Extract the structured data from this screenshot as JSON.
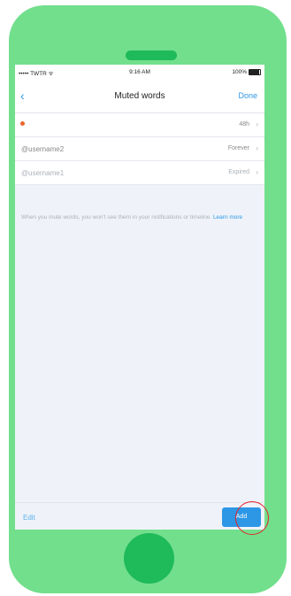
{
  "status_bar": {
    "carrier": "••••• TWTR ᯤ",
    "time": "9:16 AM",
    "battery": "100%"
  },
  "nav": {
    "back_icon": "chevron-left-icon",
    "title": "Muted words",
    "done_label": "Done"
  },
  "muted_words": [
    {
      "word": "",
      "has_dot": true,
      "duration": "48h"
    },
    {
      "word": "@username2",
      "duration": "Forever"
    },
    {
      "word": "@username1",
      "duration": "Expired"
    }
  ],
  "note": {
    "text": "When you mute words, you won't see them in your notifications or timeline.",
    "link": "Learn more"
  },
  "bottom_bar": {
    "edit_label": "Edit",
    "add_label": "Add"
  },
  "colors": {
    "phone_body": "#72df8c",
    "phone_accent": "#1fba5a",
    "link_blue": "#2d97e6",
    "highlight_ring": "#e5242a",
    "dot_orange": "#e9672a"
  }
}
